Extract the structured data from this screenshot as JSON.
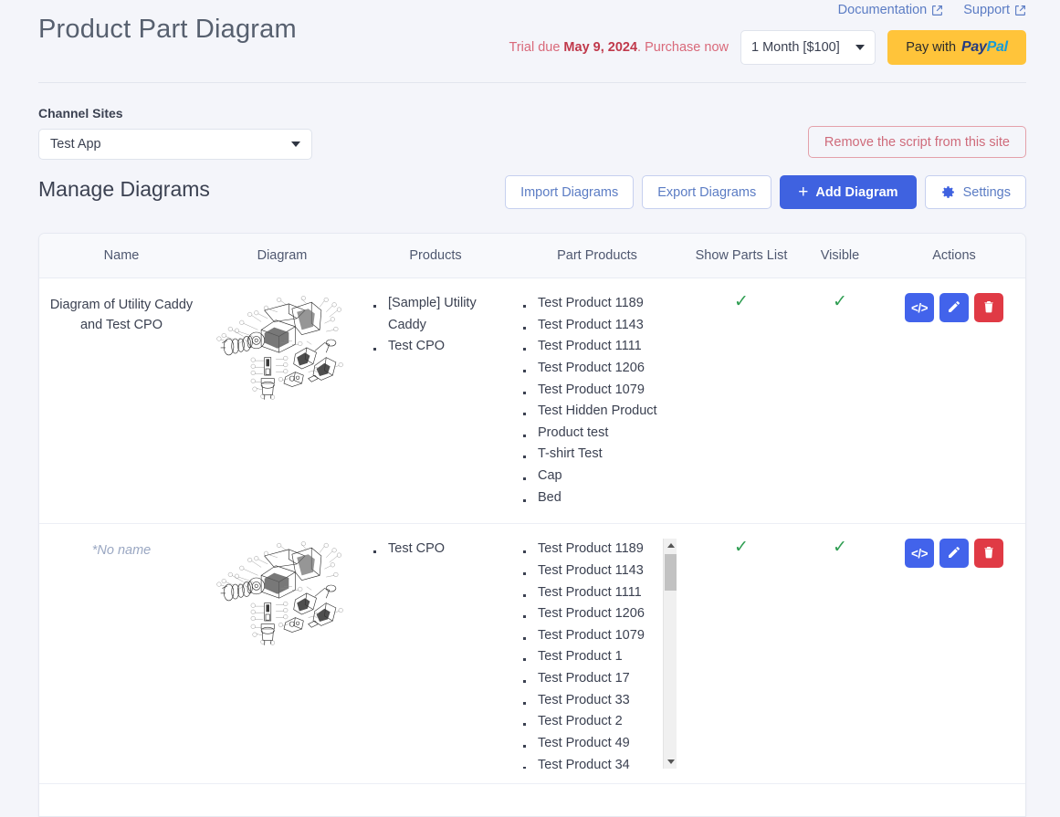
{
  "header": {
    "title": "Product Part Diagram",
    "links": [
      {
        "label": "Documentation",
        "icon": "external-link-icon"
      },
      {
        "label": "Support",
        "icon": "external-link-icon"
      }
    ],
    "trial": {
      "prefix": "Trial due ",
      "date": "May 9, 2024",
      "suffix": ". Purchase now"
    },
    "plan_select": {
      "value": "1 Month [$100]",
      "icon": "chevron-down-icon"
    },
    "paypal_button": {
      "prefix": "Pay with",
      "logo_a": "Pay",
      "logo_b": "Pal"
    }
  },
  "channel": {
    "label": "Channel Sites",
    "select_value": "Test App",
    "remove_script_label": "Remove the script from this site"
  },
  "manage": {
    "title": "Manage Diagrams",
    "import_label": "Import Diagrams",
    "export_label": "Export Diagrams",
    "add_label": "Add Diagram",
    "add_icon": "plus-icon",
    "settings_label": "Settings",
    "settings_icon": "gear-icon"
  },
  "table": {
    "columns": [
      "Name",
      "Diagram",
      "Products",
      "Part Products",
      "Show Parts List",
      "Visible",
      "Actions"
    ],
    "rows": [
      {
        "name": "Diagram of Utility Caddy and Test CPO",
        "name_is_placeholder": false,
        "diagram_alt": "exploded-parts-diagram",
        "products": [
          "[Sample] Utility Caddy",
          "Test CPO"
        ],
        "part_products": [
          "Test Product 1189",
          "Test Product 1143",
          "Test Product 1111",
          "Test Product 1206",
          "Test Product 1079",
          "Test Hidden Product",
          "Product test",
          "T-shirt Test",
          "Cap",
          "Bed"
        ],
        "part_products_scrollable": false,
        "show_parts_list": "✓",
        "visible": "✓",
        "actions": [
          {
            "name": "embed-code-button",
            "glyph": "</>"
          },
          {
            "name": "edit-button",
            "glyph": "pencil-icon"
          },
          {
            "name": "delete-button",
            "glyph": "trash-icon"
          }
        ]
      },
      {
        "name": "*No name",
        "name_is_placeholder": true,
        "diagram_alt": "exploded-parts-diagram",
        "products": [
          "Test CPO"
        ],
        "part_products": [
          "Test Product 1189",
          "Test Product 1143",
          "Test Product 1111",
          "Test Product 1206",
          "Test Product 1079",
          "Test Product 1",
          "Test Product 17",
          "Test Product 33",
          "Test Product 2",
          "Test Product 49",
          "Test Product 34"
        ],
        "part_products_scrollable": true,
        "show_parts_list": "✓",
        "visible": "✓",
        "actions": [
          {
            "name": "embed-code-button",
            "glyph": "</>"
          },
          {
            "name": "edit-button",
            "glyph": "pencil-icon"
          },
          {
            "name": "delete-button",
            "glyph": "trash-icon"
          }
        ]
      }
    ]
  },
  "colors": {
    "page_bg": "#f4f5fa",
    "primary": "#3f62e0",
    "danger": "#e03a45",
    "success": "#2f9e52",
    "trial": "#d9697a",
    "paypal_bg": "#ffc43a"
  }
}
